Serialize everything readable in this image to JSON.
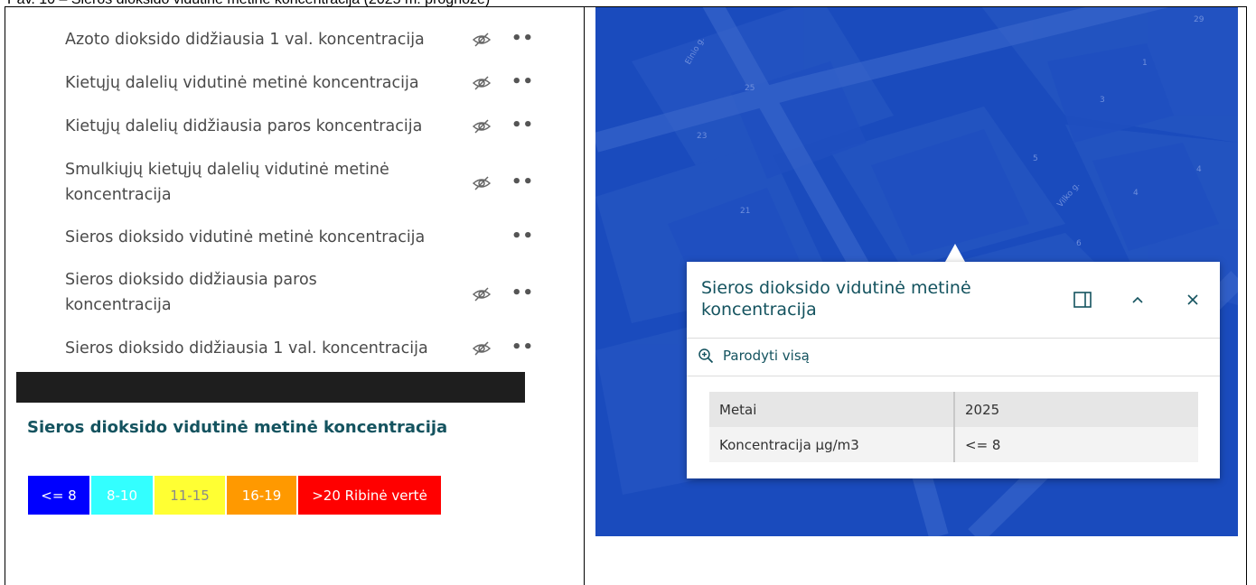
{
  "caption": "Pav. 10 – Sieros dioksido vidutinė metinė koncentracija (2025 m. prognozė)",
  "layers": [
    {
      "label": "Azoto dioksido didžiausia 1 val. koncentracija",
      "eye": "hidden-eye-icon"
    },
    {
      "label": "Kietųjų dalelių vidutinė metinė koncentracija",
      "eye": "hidden-eye-icon"
    },
    {
      "label": "Kietųjų dalelių didžiausia paros koncentracija",
      "eye": "hidden-eye-icon"
    },
    {
      "label": "Smulkiųjų kietųjų dalelių vidutinė metinė koncentracija",
      "eye": "hidden-eye-icon"
    },
    {
      "label": "Sieros dioksido vidutinė metinė koncentracija",
      "eye": "none"
    },
    {
      "label": "Sieros dioksido didžiausia paros koncentracija",
      "eye": "hidden-eye-icon"
    },
    {
      "label": "Sieros dioksido didžiausia 1 val. koncentracija",
      "eye": "hidden-eye-icon"
    }
  ],
  "more_symbol": "••",
  "legend": {
    "title": "Sieros dioksido vidutinė metinė koncentracija",
    "classes": [
      {
        "label": "<= 8",
        "color": "#0000ff",
        "text_color": "#ffffff"
      },
      {
        "label": "8-10",
        "color": "#33ffff",
        "text_color": "#ffffff"
      },
      {
        "label": "11-15",
        "color": "#ffff33",
        "text_color": "#8a8a8a"
      },
      {
        "label": "16-19",
        "color": "#ff9900",
        "text_color": "#ffffff"
      },
      {
        "label": ">20 Ribinė vertė",
        "color": "#ff0000",
        "text_color": "#ffffff"
      }
    ]
  },
  "map": {
    "labels": [
      "29",
      "1",
      "25",
      "3",
      "23",
      "5",
      "Vilko g.",
      "Elnio g.",
      "4",
      "21",
      "6",
      "4"
    ],
    "popup": {
      "title": "Sieros dioksido vidutinė metinė koncentracija",
      "zoom_label": "Parodyti visą",
      "rows": [
        {
          "key": "Metai",
          "value": "2025"
        },
        {
          "key": "Koncentracija µg/m3",
          "value": "<= 8"
        }
      ],
      "dock_icon": "dock-icon",
      "collapse_icon": "chevron-up-icon",
      "close_icon": "close-icon"
    }
  },
  "colors": {
    "accent": "#14535f",
    "map_blue": "#1a4bbd"
  }
}
